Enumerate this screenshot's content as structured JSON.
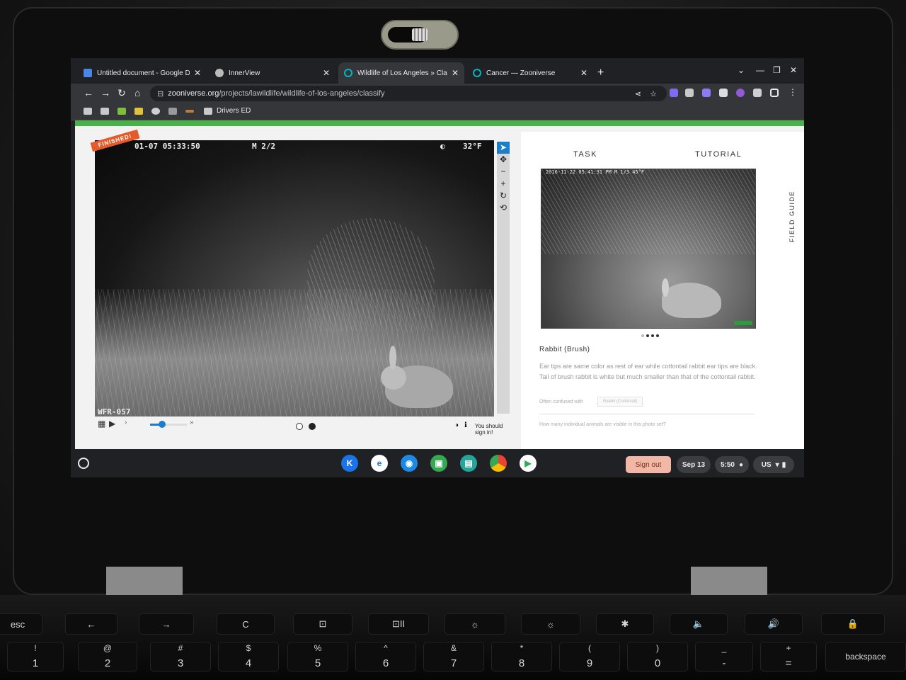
{
  "browser": {
    "tabs": [
      {
        "title": "Untitled document - Google Doc",
        "favicon_color": "#4a86e8"
      },
      {
        "title": "InnerView",
        "favicon_color": "#bbbbbb"
      },
      {
        "title": "Wildlife of Los Angeles » Classify",
        "favicon_color": "#00b6c5"
      },
      {
        "title": "Cancer — Zooniverse",
        "favicon_color": "#00b6c5"
      }
    ],
    "url_host": "zooniverse.org",
    "url_path": "/projects/lawildlife/wildlife-of-los-angeles/classify",
    "bookmark_label": "Drivers ED"
  },
  "subject": {
    "ribbon": "FINISHED!",
    "cam_timestamp": "01-07 05:33:50",
    "cam_moon": "M 2/2",
    "cam_temp": "32°F",
    "cam_id": "WFR-057",
    "signin_text": "You should sign in!",
    "tools": [
      "pointer",
      "pan",
      "zoom-out",
      "zoom-in",
      "rotate",
      "reset"
    ]
  },
  "panel": {
    "tab_task": "TASK",
    "tab_tutorial": "TUTORIAL",
    "field_guide": "FIELD GUIDE",
    "photo_stamp": "2016-11-22 05:41:31 PM   M 1/3            45°F",
    "species_name": "Rabbit (Brush)",
    "description": "Ear tips are same color as rest of ear while cottontail rabbit ear tips are black. Tail of brush rabbit is white but much smaller than that of the cottontail rabbit.",
    "confused_label": "Often confused with",
    "confused_species": "Rabbit (Cottontail)",
    "question": "How many individual animals are visible in this photo set?"
  },
  "shelf": {
    "signout": "Sign out",
    "date": "Sep 13",
    "time": "5:50",
    "locale": "US"
  },
  "keyboard": {
    "row1": [
      "esc",
      "←",
      "→",
      "C",
      "⊡",
      "⊡II",
      "☼",
      "☼",
      "✱",
      "🔈",
      "🔊",
      "🔒"
    ],
    "row2": [
      {
        "hi": "!",
        "lo": "1"
      },
      {
        "hi": "@",
        "lo": "2"
      },
      {
        "hi": "#",
        "lo": "3"
      },
      {
        "hi": "$",
        "lo": "4"
      },
      {
        "hi": "%",
        "lo": "5"
      },
      {
        "hi": "^",
        "lo": "6"
      },
      {
        "hi": "&",
        "lo": "7"
      },
      {
        "hi": "*",
        "lo": "8"
      },
      {
        "hi": "(",
        "lo": "9"
      },
      {
        "hi": ")",
        "lo": "0"
      },
      {
        "hi": "_",
        "lo": "-"
      },
      {
        "hi": "+",
        "lo": "="
      }
    ],
    "backspace": "backspace"
  }
}
